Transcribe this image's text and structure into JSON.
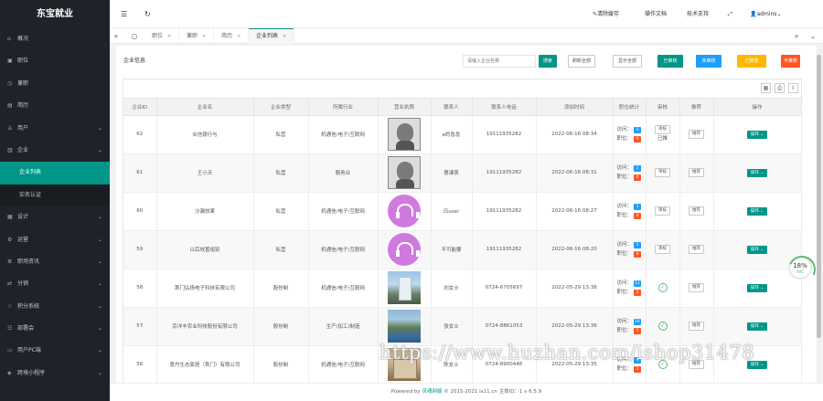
{
  "sidebar": {
    "logo": "东宝就业",
    "items": [
      {
        "label": "概况",
        "icon": "home-icon",
        "arrow": false
      },
      {
        "label": "职位",
        "icon": "briefcase-icon",
        "arrow": false
      },
      {
        "label": "兼职",
        "icon": "clock-icon",
        "arrow": false
      },
      {
        "label": "简历",
        "icon": "file-icon",
        "arrow": false
      },
      {
        "label": "用户",
        "icon": "user-icon",
        "arrow": true
      },
      {
        "label": "企业",
        "icon": "building-icon",
        "arrow": true
      }
    ],
    "sub_items": [
      {
        "label": "企业列表",
        "active": true
      },
      {
        "label": "实名认证",
        "active": false
      }
    ],
    "items_after": [
      {
        "label": "设计",
        "icon": "layout-icon",
        "arrow": true
      },
      {
        "label": "运营",
        "icon": "gear-icon",
        "arrow": true
      },
      {
        "label": "职场资讯",
        "icon": "news-icon",
        "arrow": true
      },
      {
        "label": "分销",
        "icon": "share-icon",
        "arrow": true
      },
      {
        "label": "积分系统",
        "icon": "star-icon",
        "arrow": true
      },
      {
        "label": "部署会",
        "icon": "group-icon",
        "arrow": true
      },
      {
        "label": "用户PC端",
        "icon": "monitor-icon",
        "arrow": true
      },
      {
        "label": "跨境小程序",
        "icon": "app-icon",
        "arrow": true
      }
    ]
  },
  "header": {
    "clear_cache": "清除缓存",
    "docs": "操作文档",
    "support": "技术支持",
    "user": "admins"
  },
  "tabs": [
    {
      "label": "职位",
      "active": false
    },
    {
      "label": "兼职",
      "active": false
    },
    {
      "label": "简历",
      "active": false
    },
    {
      "label": "企业列表",
      "active": true
    }
  ],
  "panel": {
    "title": "企业信息",
    "search_placeholder": "请输入企业名称",
    "buttons": {
      "search": "搜索",
      "refresh": "刷新全部",
      "show_all": "显示全部",
      "audited": "已审核",
      "not_audited": "未审核",
      "rec": "已推荐",
      "unrec": "不推荐"
    }
  },
  "table": {
    "headers": [
      "企业ID",
      "企业名",
      "企业类型",
      "所属行业",
      "营业执照",
      "联系人",
      "联系人电话",
      "添加时间",
      "职位统计",
      "审核",
      "推荐",
      "操作"
    ],
    "visits_label": "访问：",
    "jobs_label": "职位：",
    "op_label": "操作",
    "rows": [
      {
        "id": "62",
        "name": "合信银行与",
        "type": "私营",
        "industry": "机通信/电子/互联网",
        "img": "av1",
        "contact": "e的急急",
        "phone": "19111935282",
        "time": "2022-06-16 08:34",
        "visits": "5",
        "jobs": "0",
        "audit": "btns",
        "audit_a": "审核",
        "audit_b": "已推",
        "rec": "推荐"
      },
      {
        "id": "61",
        "name": "王小天",
        "type": "私营",
        "industry": "服务业",
        "img": "av1",
        "contact": "第课表",
        "phone": "19111935282",
        "time": "2022-06-16 08:31",
        "visits": "2",
        "jobs": "0",
        "audit": "btn",
        "audit_a": "审核",
        "audit_b": "",
        "rec": "推荐"
      },
      {
        "id": "60",
        "name": "沙漏效果",
        "type": "私营",
        "industry": "机通信/电子/互联网",
        "img": "pink",
        "contact": "日user",
        "phone": "19111935282",
        "time": "2022-06-16 08:27",
        "visits": "1",
        "jobs": "0",
        "audit": "btn",
        "audit_a": "审核",
        "audit_b": "",
        "rec": "推荐"
      },
      {
        "id": "59",
        "name": "以后效置组别",
        "type": "私营",
        "industry": "机通信/电子/互联网",
        "img": "pink",
        "contact": "不可能要",
        "phone": "19111935282",
        "time": "2022-06-16 08:20",
        "visits": "1",
        "jobs": "0",
        "audit": "btn",
        "audit_a": "审核",
        "audit_b": "",
        "rec": "推荐"
      },
      {
        "id": "58",
        "name": "荆门弘扬电子科技有限公司",
        "type": "股份制",
        "industry": "机通信/电子/互联网",
        "img": "bld",
        "contact": "刘女士",
        "phone": "0724-6705697",
        "time": "2022-05-29 13:38",
        "visits": "11",
        "jobs": "1",
        "audit": "check",
        "audit_a": "",
        "audit_b": "",
        "rec": "推荐"
      },
      {
        "id": "57",
        "name": "京洋丰农业科技股份有限公司",
        "type": "股份制",
        "industry": "生产/加工/制造",
        "img": "riv",
        "contact": "张女士",
        "phone": "0724-8861053",
        "time": "2022-05-29 13:36",
        "visits": "16",
        "jobs": "2",
        "audit": "check",
        "audit_a": "",
        "audit_b": "",
        "rec": "推荐"
      },
      {
        "id": "56",
        "name": "意丹生态家居（荆门）有限公司",
        "type": "股份制",
        "industry": "机通信/电子/互联网",
        "img": "old",
        "contact": "陈女士",
        "phone": "0724-8900448",
        "time": "2022-05-29 13:35",
        "visits": "9",
        "jobs": "1",
        "audit": "check",
        "audit_a": "",
        "audit_b": "",
        "rec": "推荐"
      }
    ]
  },
  "footer": {
    "powered": "Powered by",
    "brand": "灵魂网络",
    "rest": "© 2015-2021 ls11.cn 主体ID：1  v 6.5.9"
  },
  "progress": {
    "value": "18%",
    "sub": "ARC",
    "percent": 18
  },
  "watermark": "https://www.huzhan.com/ishop31478",
  "colors": {
    "accent": "#009688",
    "sidebar": "#20222a",
    "blue": "#1e9fff",
    "orange": "#ffb800",
    "red": "#ff5722"
  }
}
